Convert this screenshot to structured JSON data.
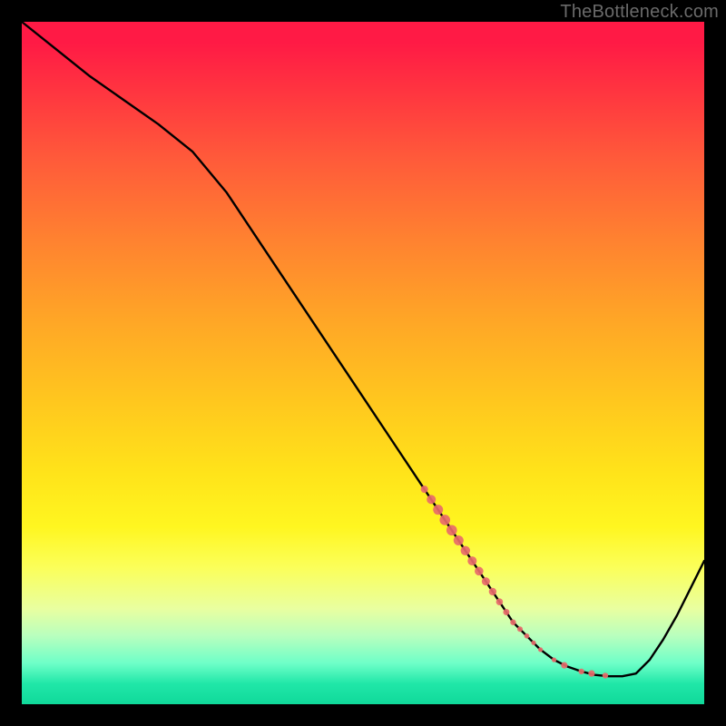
{
  "watermark": "TheBottleneck.com",
  "colors": {
    "curve_stroke": "#000000",
    "marker_fill": "#e86a6a",
    "marker_stroke": "#e86a6a"
  },
  "chart_data": {
    "type": "line",
    "title": "",
    "xlabel": "",
    "ylabel": "",
    "xlim": [
      0,
      100
    ],
    "ylim": [
      0,
      100
    ],
    "grid": false,
    "series": [
      {
        "name": "bottleneck-curve",
        "x": [
          0,
          5,
          10,
          15,
          20,
          25,
          30,
          35,
          40,
          45,
          50,
          55,
          60,
          62,
          65,
          68,
          70,
          72,
          74,
          76,
          78,
          80,
          82,
          84,
          86,
          88,
          90,
          92,
          94,
          96,
          98,
          100
        ],
        "values": [
          100,
          96,
          92,
          88.5,
          85,
          81,
          75,
          67.5,
          60,
          52.5,
          45,
          37.5,
          30,
          27,
          22.5,
          18,
          15,
          12,
          10,
          8,
          6.5,
          5.5,
          4.8,
          4.3,
          4.1,
          4.1,
          4.5,
          6.5,
          9.5,
          13,
          17,
          21
        ]
      }
    ],
    "markers": [
      {
        "x": 59,
        "y": 31.5,
        "r": 4.0
      },
      {
        "x": 60,
        "y": 30.0,
        "r": 5.0
      },
      {
        "x": 61,
        "y": 28.5,
        "r": 5.5
      },
      {
        "x": 62,
        "y": 27.0,
        "r": 5.8
      },
      {
        "x": 63,
        "y": 25.5,
        "r": 5.8
      },
      {
        "x": 64,
        "y": 24.0,
        "r": 5.5
      },
      {
        "x": 65,
        "y": 22.5,
        "r": 5.2
      },
      {
        "x": 66,
        "y": 21.0,
        "r": 5.0
      },
      {
        "x": 67,
        "y": 19.5,
        "r": 4.8
      },
      {
        "x": 68,
        "y": 18.0,
        "r": 4.5
      },
      {
        "x": 69,
        "y": 16.5,
        "r": 4.2
      },
      {
        "x": 70,
        "y": 15.0,
        "r": 3.8
      },
      {
        "x": 71,
        "y": 13.5,
        "r": 3.5
      },
      {
        "x": 72,
        "y": 12.0,
        "r": 3.2
      },
      {
        "x": 73,
        "y": 11.0,
        "r": 3.0
      },
      {
        "x": 74,
        "y": 10.0,
        "r": 2.8
      },
      {
        "x": 75,
        "y": 9.0,
        "r": 2.6
      },
      {
        "x": 76,
        "y": 8.0,
        "r": 2.6
      },
      {
        "x": 78,
        "y": 6.5,
        "r": 2.6
      },
      {
        "x": 79.5,
        "y": 5.7,
        "r": 3.6
      },
      {
        "x": 82,
        "y": 4.8,
        "r": 3.2
      },
      {
        "x": 83.5,
        "y": 4.5,
        "r": 3.6
      },
      {
        "x": 85.5,
        "y": 4.2,
        "r": 3.2
      }
    ]
  }
}
